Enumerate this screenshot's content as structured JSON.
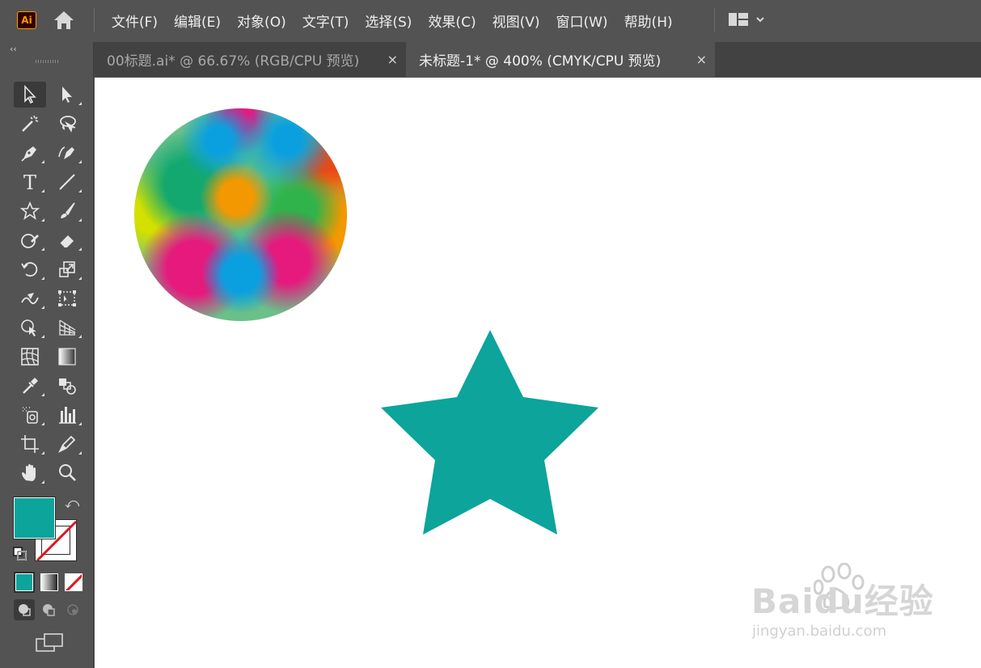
{
  "app": {
    "logo_text": "Ai"
  },
  "menu": {
    "items": [
      {
        "label": "文件(F)"
      },
      {
        "label": "编辑(E)"
      },
      {
        "label": "对象(O)"
      },
      {
        "label": "文字(T)"
      },
      {
        "label": "选择(S)"
      },
      {
        "label": "效果(C)"
      },
      {
        "label": "视图(V)"
      },
      {
        "label": "窗口(W)"
      },
      {
        "label": "帮助(H)"
      }
    ]
  },
  "tabs": [
    {
      "label": "00标题.ai* @ 66.67% (RGB/CPU 预览)",
      "close": "×",
      "active": false
    },
    {
      "label": "未标题-1* @ 400% (CMYK/CPU 预览)",
      "close": "×",
      "active": true
    }
  ],
  "toolbar": {
    "collapse": "‹‹",
    "tools": [
      {
        "icon": "selection-tool-icon"
      },
      {
        "icon": "direct-selection-tool-icon"
      },
      {
        "icon": "magic-wand-tool-icon"
      },
      {
        "icon": "lasso-tool-icon"
      },
      {
        "icon": "pen-tool-icon"
      },
      {
        "icon": "curvature-tool-icon"
      },
      {
        "icon": "type-tool-icon"
      },
      {
        "icon": "line-segment-tool-icon"
      },
      {
        "icon": "star-tool-icon"
      },
      {
        "icon": "paintbrush-tool-icon"
      },
      {
        "icon": "shaper-tool-icon"
      },
      {
        "icon": "eraser-tool-icon"
      },
      {
        "icon": "rotate-tool-icon"
      },
      {
        "icon": "scale-tool-icon"
      },
      {
        "icon": "warp-tool-icon"
      },
      {
        "icon": "free-transform-tool-icon"
      },
      {
        "icon": "shape-builder-tool-icon"
      },
      {
        "icon": "perspective-grid-tool-icon"
      },
      {
        "icon": "mesh-tool-icon"
      },
      {
        "icon": "gradient-tool-icon"
      },
      {
        "icon": "eyedropper-tool-icon"
      },
      {
        "icon": "blend-tool-icon"
      },
      {
        "icon": "symbol-sprayer-tool-icon"
      },
      {
        "icon": "column-graph-tool-icon"
      },
      {
        "icon": "artboard-tool-icon"
      },
      {
        "icon": "slice-tool-icon"
      },
      {
        "icon": "hand-tool-icon"
      },
      {
        "icon": "zoom-tool-icon"
      }
    ],
    "type_glyph": "T"
  },
  "colors": {
    "fill": "#0ca49b",
    "stroke": "none",
    "star": "#0ca49b"
  },
  "watermark": {
    "logo": "Baidu经验",
    "url": "jingyan.baidu.com"
  }
}
